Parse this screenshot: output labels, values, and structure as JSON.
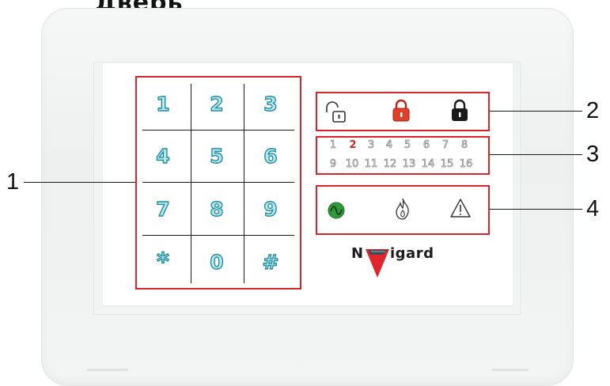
{
  "heading_fragment": "Дверь",
  "keypad": {
    "keys": [
      "1",
      "2",
      "3",
      "4",
      "5",
      "6",
      "7",
      "8",
      "9",
      "*",
      "0",
      "#"
    ]
  },
  "status_icons": [
    {
      "name": "unlocked-padlock-icon",
      "color": "#ffffff"
    },
    {
      "name": "red-padlock-icon",
      "color": "#e0402a"
    },
    {
      "name": "black-padlock-icon",
      "color": "#1a1a1a"
    }
  ],
  "zones": {
    "row1": [
      "1",
      "2",
      "3",
      "4",
      "5",
      "6",
      "7",
      "8"
    ],
    "row2": [
      "9",
      "10",
      "11",
      "12",
      "13",
      "14",
      "15",
      "16"
    ],
    "active_zone": "2",
    "active_color": "#d12a22"
  },
  "event_icons": [
    {
      "name": "power-icon",
      "color": "#2e9a3a"
    },
    {
      "name": "fire-icon",
      "color": "#ffffff"
    },
    {
      "name": "warning-triangle-icon",
      "color": "#ffffff"
    }
  ],
  "brand": {
    "name": "NAVigard",
    "accent": "#d9242b"
  },
  "callouts": [
    "1",
    "2",
    "3",
    "4"
  ],
  "colors": {
    "highlight": "#d9242b",
    "key_fill": "#bfe7ee",
    "key_stroke": "#1b8fa2"
  }
}
